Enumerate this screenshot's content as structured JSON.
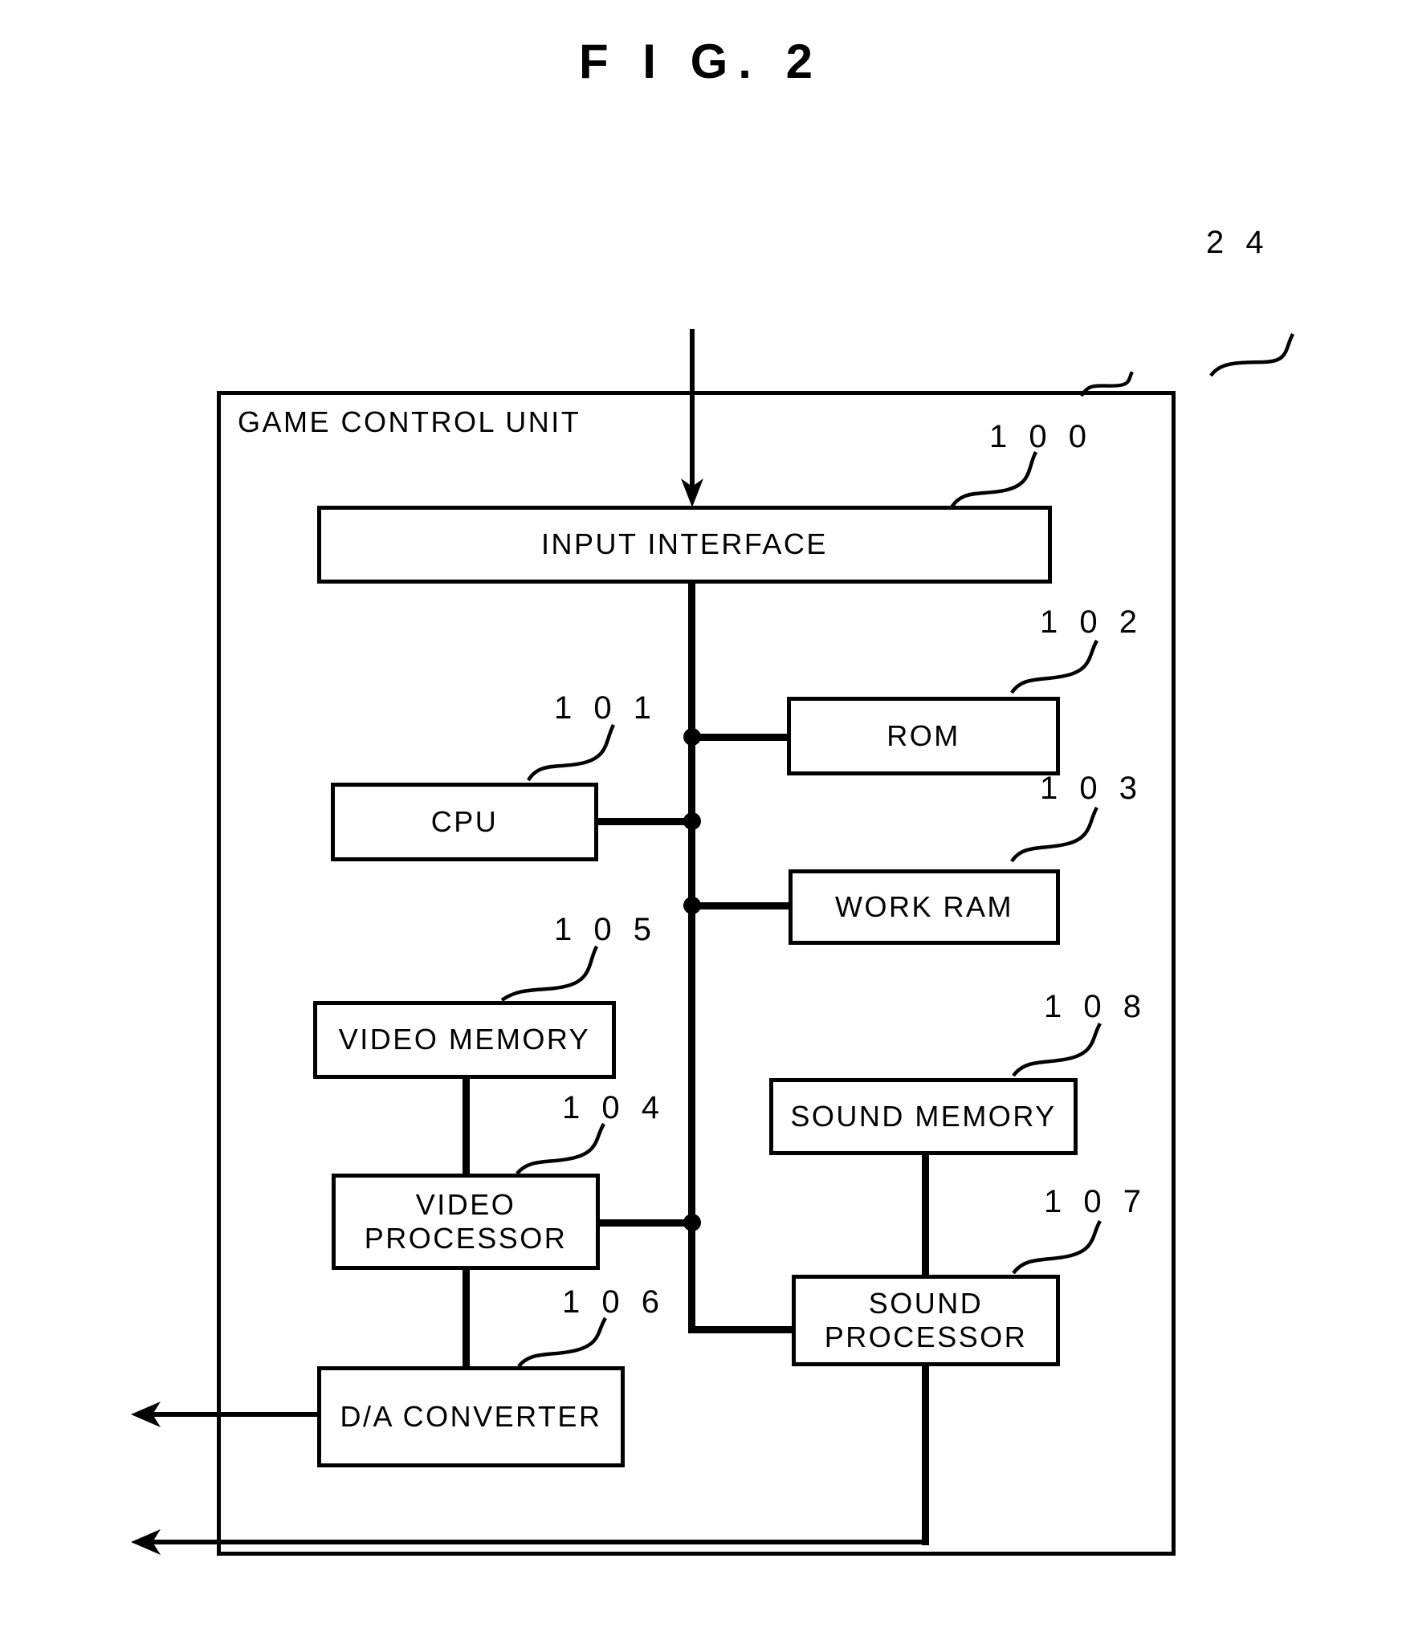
{
  "figure": {
    "title": "F I G.  2",
    "unit_label": "GAME CONTROL UNIT",
    "unit_ref": "2 4"
  },
  "blocks": [
    {
      "id": "input-interface",
      "label": "INPUT INTERFACE",
      "ref": "1 0 0"
    },
    {
      "id": "cpu",
      "label": "CPU",
      "ref": "1 0 1"
    },
    {
      "id": "rom",
      "label": "ROM",
      "ref": "1 0 2"
    },
    {
      "id": "work-ram",
      "label": "WORK RAM",
      "ref": "1 0 3"
    },
    {
      "id": "video-memory",
      "label": "VIDEO MEMORY",
      "ref": "1 0 5"
    },
    {
      "id": "video-processor",
      "label_line1": "VIDEO",
      "label_line2": "PROCESSOR",
      "ref": "1 0 4"
    },
    {
      "id": "sound-memory",
      "label": "SOUND MEMORY",
      "ref": "1 0 8"
    },
    {
      "id": "sound-processor",
      "label_line1": "SOUND",
      "label_line2": "PROCESSOR",
      "ref": "1 0 7"
    },
    {
      "id": "da-converter",
      "label": "D/A CONVERTER",
      "ref": "1 0 6"
    }
  ],
  "colors": {
    "ink": "#000000",
    "paper": "#ffffff"
  }
}
